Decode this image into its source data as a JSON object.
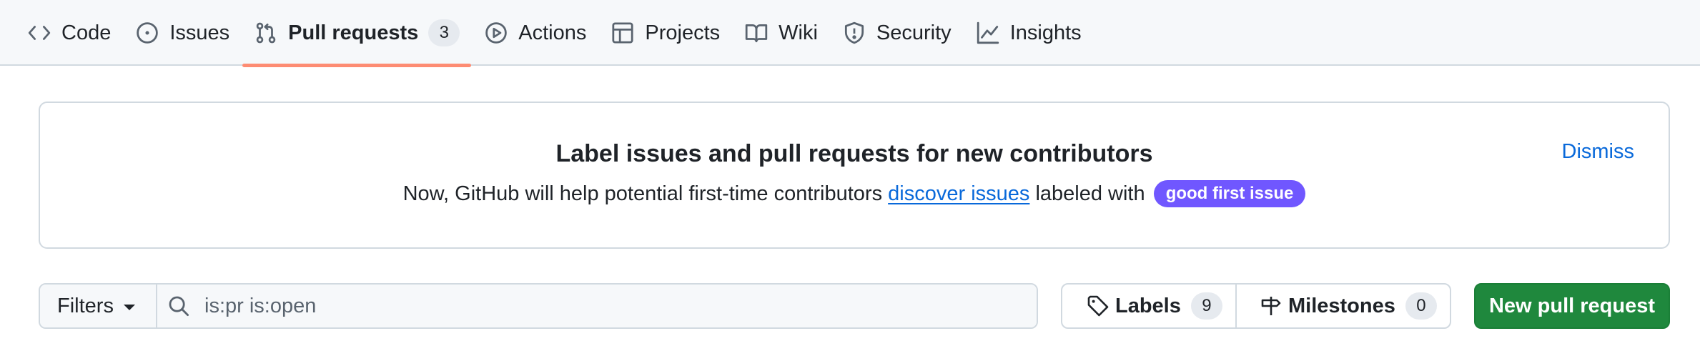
{
  "nav": {
    "tabs": [
      {
        "label": "Code",
        "icon": "code-icon"
      },
      {
        "label": "Issues",
        "icon": "issue-opened-icon"
      },
      {
        "label": "Pull requests",
        "icon": "git-pull-request-icon",
        "count": "3",
        "selected": true
      },
      {
        "label": "Actions",
        "icon": "play-icon"
      },
      {
        "label": "Projects",
        "icon": "table-icon"
      },
      {
        "label": "Wiki",
        "icon": "book-icon"
      },
      {
        "label": "Security",
        "icon": "shield-icon"
      },
      {
        "label": "Insights",
        "icon": "graph-icon"
      }
    ]
  },
  "banner": {
    "title": "Label issues and pull requests for new contributors",
    "text_before": "Now, GitHub will help potential first-time contributors ",
    "link": "discover issues",
    "text_after": " labeled with ",
    "label": "good first issue",
    "dismiss": "Dismiss"
  },
  "filterbar": {
    "filters_label": "Filters",
    "search_value": "is:pr is:open",
    "labels_label": "Labels",
    "labels_count": "9",
    "milestones_label": "Milestones",
    "milestones_count": "0",
    "new_pr_label": "New pull request"
  },
  "colors": {
    "selected_underline": "#fd8c73",
    "link": "#0969da",
    "label_pill": "#7057ff",
    "primary_button": "#1f883d"
  }
}
